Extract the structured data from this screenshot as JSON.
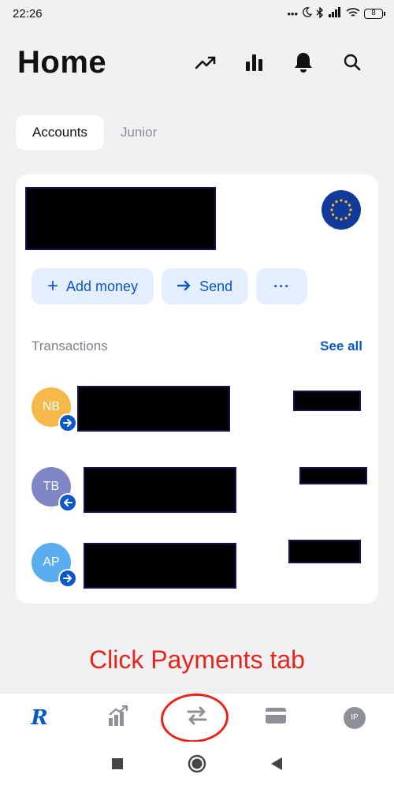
{
  "status_bar": {
    "time": "22:26",
    "battery": "8",
    "indicators": [
      "more-icon",
      "moon-icon",
      "bluetooth-icon",
      "signal-icon",
      "wifi-icon"
    ]
  },
  "header": {
    "title": "Home",
    "icons": [
      "trending-icon",
      "bar-chart-icon",
      "bell-icon",
      "search-icon"
    ]
  },
  "segments": {
    "tabs": [
      {
        "label": "Accounts",
        "active": true
      },
      {
        "label": "Junior",
        "active": false
      }
    ]
  },
  "account_card": {
    "actions": {
      "add_money": "Add money",
      "send": "Send",
      "more": "···"
    },
    "transactions": {
      "title": "Transactions",
      "see_all": "See all",
      "items": [
        {
          "initials": "NB",
          "color": "#f7b84a",
          "direction": "outgoing"
        },
        {
          "initials": "TB",
          "color": "#7f86c6",
          "direction": "incoming"
        },
        {
          "initials": "AP",
          "color": "#5aaef0",
          "direction": "outgoing"
        }
      ]
    }
  },
  "annotation": "Click Payments tab",
  "bottom_nav": {
    "items": [
      {
        "name": "home",
        "glyph": "R"
      },
      {
        "name": "wealth"
      },
      {
        "name": "payments"
      },
      {
        "name": "cards"
      },
      {
        "name": "profile",
        "initials": "IP"
      }
    ]
  },
  "colors": {
    "accent": "#0a58ca",
    "annotation": "#e8251b",
    "background": "#f1f1f4"
  }
}
